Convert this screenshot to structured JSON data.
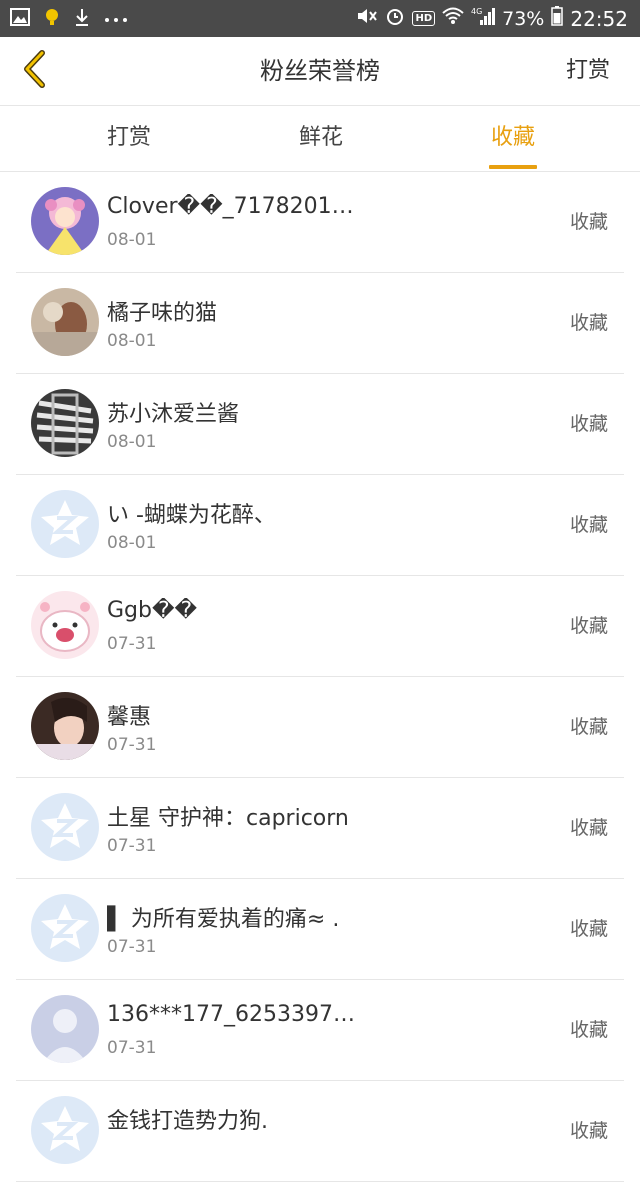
{
  "status_bar": {
    "battery_percent": "73%",
    "time": "22:52",
    "signal_label": "4G",
    "hd_label": "HD",
    "icons": [
      "gallery-icon",
      "notification-icon",
      "download-icon",
      "more-dots-icon",
      "mute-icon",
      "alarm-icon",
      "wifi-icon",
      "signal-icon",
      "battery-icon"
    ]
  },
  "header": {
    "title": "粉丝荣誉榜",
    "right_action": "打赏",
    "back_icon": "chevron-left-icon",
    "accent": "#e8a010"
  },
  "tabs": [
    {
      "label": "打赏",
      "active": false
    },
    {
      "label": "鲜花",
      "active": false
    },
    {
      "label": "收藏",
      "active": true
    }
  ],
  "list": [
    {
      "name": "Clover��_7178201…",
      "date": "08-01",
      "action": "收藏",
      "avatar": "anime-girl-avatar"
    },
    {
      "name": "橘子味的猫",
      "date": "08-01",
      "action": "收藏",
      "avatar": "photo-avatar"
    },
    {
      "name": "苏小沐爱兰酱",
      "date": "08-01",
      "action": "收藏",
      "avatar": "striped-avatar"
    },
    {
      "name": "い -蝴蝶为花醉、",
      "date": "08-01",
      "action": "收藏",
      "avatar": "default-z-avatar"
    },
    {
      "name": "Ggb��",
      "date": "07-31",
      "action": "收藏",
      "avatar": "cartoon-pig-avatar"
    },
    {
      "name": "馨惠",
      "date": "07-31",
      "action": "收藏",
      "avatar": "girl-photo-avatar"
    },
    {
      "name": "土星 守护神：capricorn",
      "date": "07-31",
      "action": "收藏",
      "avatar": "default-z-avatar"
    },
    {
      "name": "▌ 为所有爱执着的痛≈ .",
      "date": "07-31",
      "action": "收藏",
      "avatar": "default-z-avatar"
    },
    {
      "name": "136***177_6253397…",
      "date": "07-31",
      "action": "收藏",
      "avatar": "default-person-avatar"
    },
    {
      "name": "金钱打造势力狗.",
      "date": "",
      "action": "收藏",
      "avatar": "default-z-avatar"
    }
  ]
}
